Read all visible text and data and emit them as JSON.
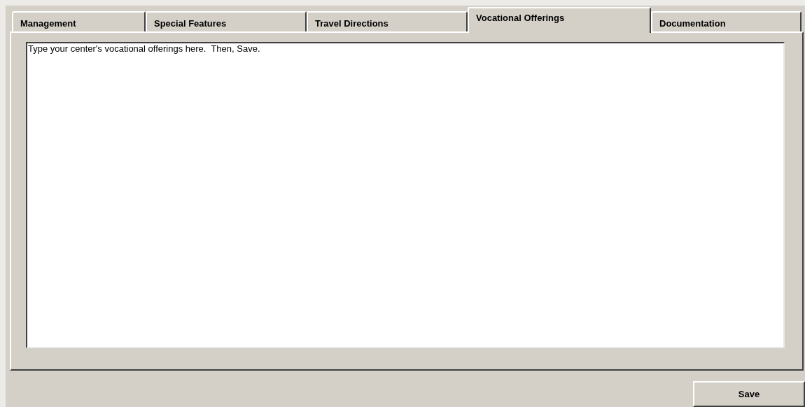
{
  "tabs": [
    {
      "label": "Management",
      "selected": false
    },
    {
      "label": "Special Features",
      "selected": false
    },
    {
      "label": "Travel Directions",
      "selected": false
    },
    {
      "label": "Vocational Offerings",
      "selected": true
    },
    {
      "label": "Documentation",
      "selected": false
    }
  ],
  "editor": {
    "value": "Type your center's vocational offerings here.  Then, Save."
  },
  "buttons": [
    {
      "label": "Save"
    }
  ]
}
